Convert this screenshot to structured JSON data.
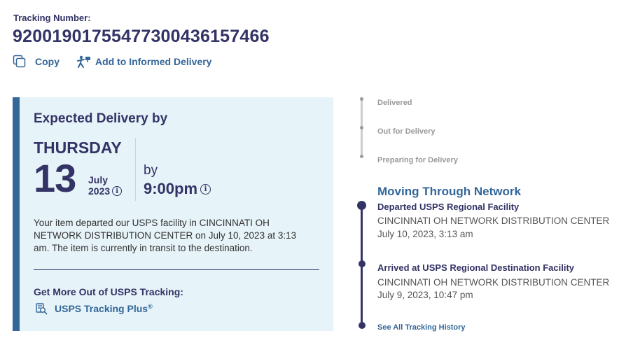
{
  "tracking": {
    "label": "Tracking Number:",
    "number": "9200190175547730043615746 6"
  },
  "actions": {
    "copy_label": "Copy",
    "informed_label": "Add to Informed Delivery"
  },
  "delivery": {
    "title": "Expected Delivery by",
    "day": "THURSDAY",
    "date": "13",
    "month": "July",
    "year": "2023",
    "by": "by",
    "time": "9:00pm",
    "info_glyph": "i",
    "status_text": "Your item departed our USPS facility in CINCINNATI OH NETWORK DISTRIBUTION CENTER on July 10, 2023 at 3:13 am. The item is currently in transit to the destination.",
    "more_title": "Get More Out of USPS Tracking:",
    "plus_label": "USPS Tracking Plus",
    "plus_reg": "®"
  },
  "timeline": {
    "steps": [
      "Delivered",
      "Out for Delivery",
      "Preparing for Delivery"
    ],
    "current_heading": "Moving Through Network",
    "events": [
      {
        "title": "Departed USPS Regional Facility",
        "location": "CINCINNATI OH NETWORK DISTRIBUTION CENTER",
        "time": "July 10, 2023, 3:13 am"
      },
      {
        "title": "Arrived at USPS Regional Destination Facility",
        "location": "CINCINNATI OH NETWORK DISTRIBUTION CENTER",
        "time": "July 9, 2023, 10:47 pm"
      }
    ],
    "see_all": "See All Tracking History"
  },
  "colors": {
    "navy": "#333366",
    "link_blue": "#336699",
    "card_bg": "#e6f3f8",
    "muted": "#999999"
  },
  "icons": [
    "copy-icon",
    "informed-delivery-icon",
    "info-icon",
    "tracking-plus-icon"
  ]
}
